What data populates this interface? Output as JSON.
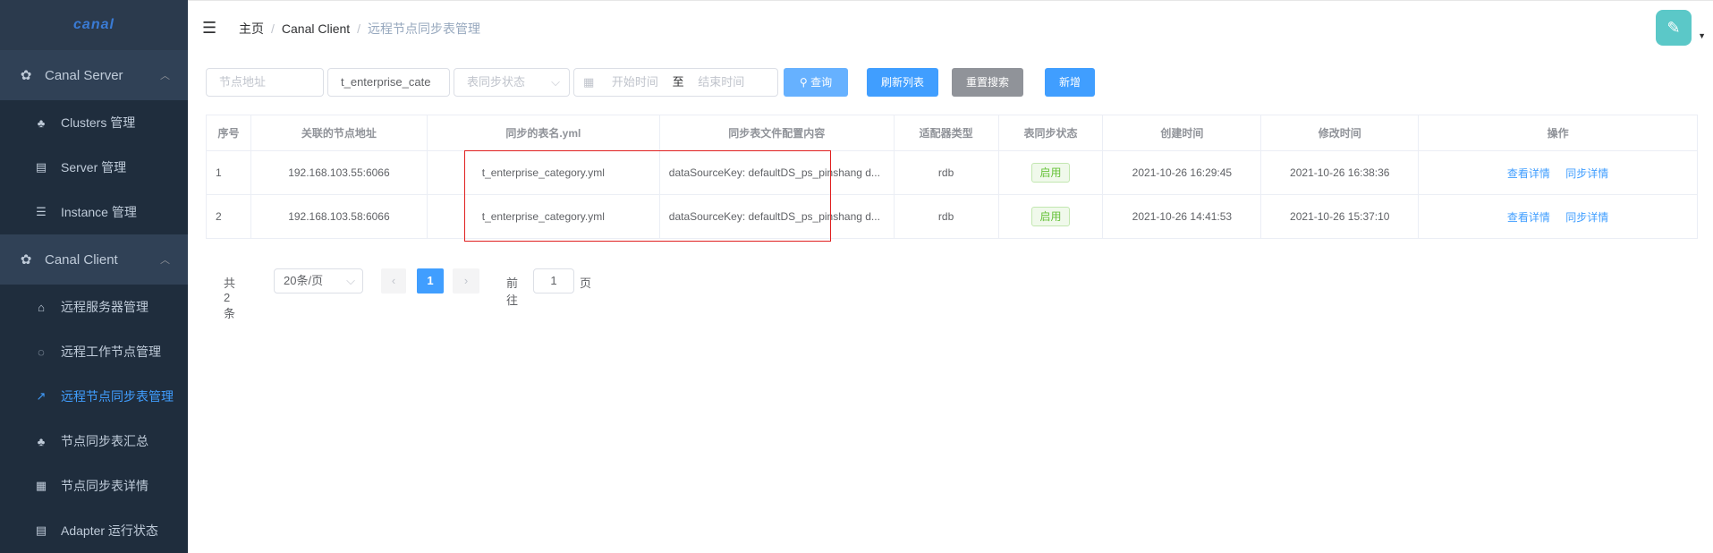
{
  "sidebar": {
    "logo": "canal",
    "groups": [
      {
        "label": "Canal Server",
        "items": [
          {
            "label": "Clusters 管理",
            "icon": "sitemap-icon"
          },
          {
            "label": "Server 管理",
            "icon": "document-edit-icon"
          },
          {
            "label": "Instance 管理",
            "icon": "list-icon"
          }
        ]
      },
      {
        "label": "Canal Client",
        "items": [
          {
            "label": "远程服务器管理",
            "icon": "server-icon"
          },
          {
            "label": "远程工作节点管理",
            "icon": "chat-icon"
          },
          {
            "label": "远程节点同步表管理",
            "icon": "external-link-icon"
          },
          {
            "label": "节点同步表汇总",
            "icon": "sitemap-icon"
          },
          {
            "label": "节点同步表详情",
            "icon": "grid-icon"
          },
          {
            "label": "Adapter 运行状态",
            "icon": "document-edit-icon"
          }
        ]
      }
    ]
  },
  "breadcrumb": [
    "主页",
    "Canal Client",
    "远程节点同步表管理"
  ],
  "filters": {
    "node_placeholder": "节点地址",
    "table_value": "t_enterprise_cate",
    "status_placeholder": "表同步状态",
    "start_placeholder": "开始时间",
    "range_sep": "至",
    "end_placeholder": "结束时间",
    "search": "查询",
    "refresh": "刷新列表",
    "reset": "重置搜索",
    "add": "新增"
  },
  "table": {
    "headers": [
      "序号",
      "关联的节点地址",
      "同步的表名.yml",
      "同步表文件配置内容",
      "适配器类型",
      "表同步状态",
      "创建时间",
      "修改时间",
      "操作"
    ],
    "rows": [
      {
        "idx": "1",
        "node": "192.168.103.55:6066",
        "yml": "t_enterprise_category.yml",
        "config": "dataSourceKey: defaultDS_ps_pinshang d...",
        "adapter": "rdb",
        "status": "启用",
        "created": "2021-10-26 16:29:45",
        "modified": "2021-10-26 16:38:36",
        "view": "查看详情",
        "sync": "同步详情"
      },
      {
        "idx": "2",
        "node": "192.168.103.58:6066",
        "yml": "t_enterprise_category.yml",
        "config": "dataSourceKey: defaultDS_ps_pinshang d...",
        "adapter": "rdb",
        "status": "启用",
        "created": "2021-10-26 14:41:53",
        "modified": "2021-10-26 15:37:10",
        "view": "查看详情",
        "sync": "同步详情"
      }
    ]
  },
  "pagination": {
    "total": "共 2 条",
    "page_size": "20条/页",
    "current": "1",
    "goto_label": "前往",
    "goto_value": "1",
    "page_suffix": "页"
  }
}
